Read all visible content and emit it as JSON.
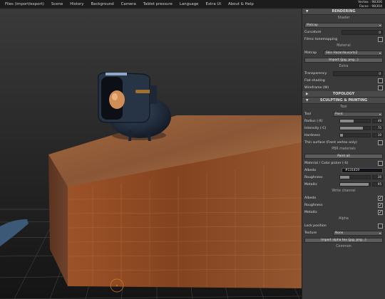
{
  "menu": [
    "Files (import/export)",
    "Scene",
    "History",
    "Background",
    "Camera",
    "Tablet pressure",
    "Language",
    "Extra UI",
    "About & Help"
  ],
  "stats": {
    "vertex": "Vertex : 98306",
    "faces": "Faces : 98304"
  },
  "rendering": {
    "title": "RENDERING",
    "shader_header": "Shader",
    "shader_value": "Matcap",
    "curvature_label": "Curvature",
    "curvature_value": "0",
    "filmic_label": "Filmic tonemapping",
    "material_header": "Material",
    "matcap_label": "Matcap",
    "matcap_value": "Skin Hazardousarts2",
    "import_label": "Import (jpg, png...)",
    "extra_header": "Extra",
    "transparency_label": "Transparency",
    "transparency_value": "0",
    "flat_label": "Flat shading",
    "wireframe_label": "Wireframe (W)"
  },
  "topology": {
    "title": "TOPOLOGY"
  },
  "sculpting": {
    "title": "SCULPTING & PAINTING",
    "tool_header": "Tool",
    "tool_label": "Tool",
    "tool_value": "Paint",
    "radius_label": "Radius (-X)",
    "radius_value": "46",
    "radius_fraction": 0.46,
    "intensity_label": "Intensity (-C)",
    "intensity_value": "75",
    "intensity_fraction": 0.75,
    "hardness_label": "Hardness",
    "hardness_value": "10",
    "hardness_fraction": 0.1,
    "thin_label": "Thin surface (Front vertex only)",
    "pbr_header": "PBR materials",
    "paint_all_label": "Paint all",
    "material_picker_label": "Material / Color picker (-S)",
    "albedo_label": "Albedo",
    "albedo_value": "#131419",
    "roughness_label": "Roughness",
    "roughness_value": "30",
    "roughness_fraction": 0.3,
    "metallic_label": "Metallic",
    "metallic_value": "95",
    "metallic_fraction": 0.95,
    "write_header": "Write channel",
    "write_albedo": "Albedo",
    "write_roughness": "Roughness",
    "write_metallic": "Metallic",
    "alpha_header": "Alpha",
    "lock_label": "Lock position",
    "texture_label": "Texture",
    "texture_value": "None",
    "import_alpha_label": "Import alpha tex (jpg, png...)",
    "common_header": "Common"
  },
  "check_mark": "✓",
  "collapsed_icon": "▶",
  "expanded_icon": "▼",
  "dropdown_icon": "▾"
}
